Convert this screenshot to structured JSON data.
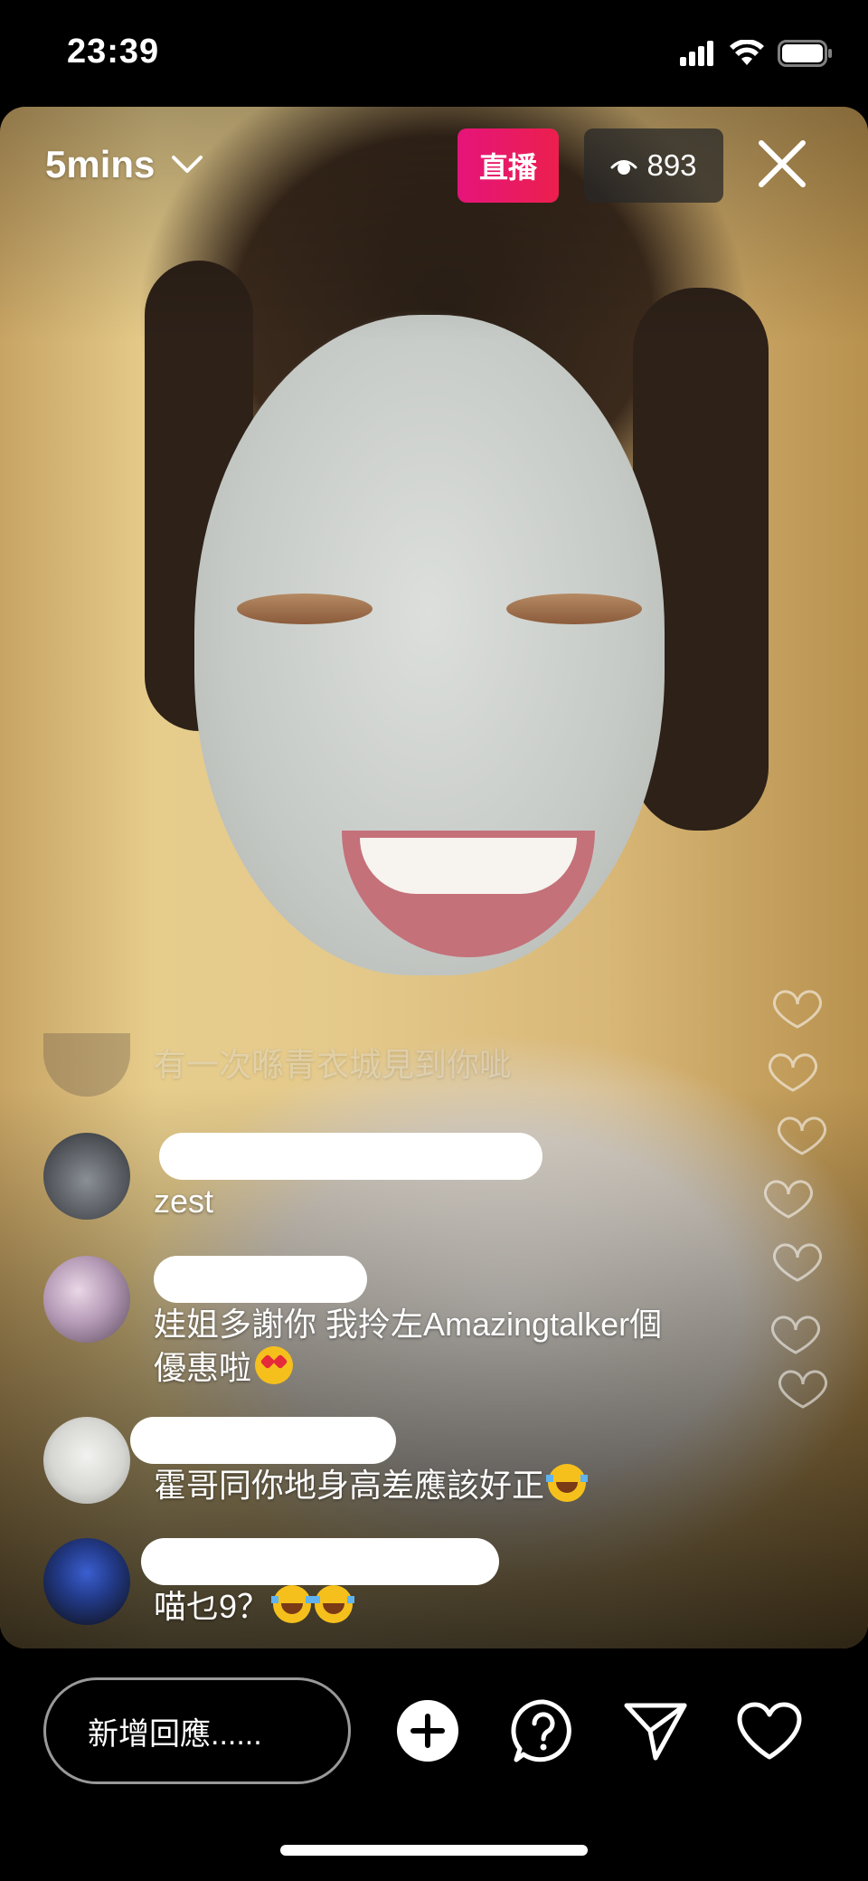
{
  "status_bar": {
    "time": "23:39",
    "icons": [
      "cellular-signal-icon",
      "wifi-icon",
      "battery-icon"
    ]
  },
  "header": {
    "title": "5mins",
    "live_label": "直播",
    "viewer_count": "893",
    "icons": [
      "chevron-down-icon",
      "eye-icon",
      "close-icon"
    ]
  },
  "comments": {
    "faded": "有一次喺青衣城見到你呲",
    "items": [
      {
        "text": "zest",
        "emoji": ""
      },
      {
        "text": "娃姐多謝你 我拎左Amazingtalker個",
        "text2": "優惠啦",
        "emoji": "heart-eyes"
      },
      {
        "text": "霍哥同你地身高差應該好正",
        "emoji": "laugh"
      },
      {
        "text": "喵乜9？",
        "emoji": "laugh-laugh"
      }
    ]
  },
  "footer": {
    "input_placeholder": "新增回應......",
    "actions": [
      "add-icon",
      "question-icon",
      "send-icon",
      "heart-icon"
    ]
  },
  "colors": {
    "live_badge": "#e5147a",
    "background": "#000000",
    "text": "#ffffff"
  }
}
